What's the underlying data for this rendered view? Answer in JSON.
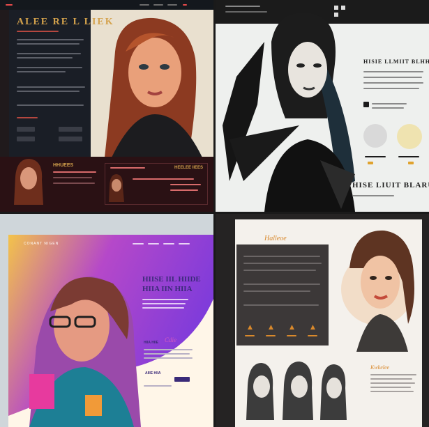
{
  "panel_top_left": {
    "heading": "ALEE RE L LIEK",
    "card_title": "HHUEES",
    "card_tag": "HEELEE IIEES",
    "colors": {
      "accent": "#d4a24c",
      "pink": "#d86b6b",
      "bg": "#201a1c",
      "beige": "#e9e0cf"
    }
  },
  "panel_top_right": {
    "heading": "HISIE LLMIIT BLHHLL",
    "hero_text": "HISE LIUIT BLARUL",
    "nav_icons": [
      "square-icon",
      "square-icon",
      "square-icon"
    ]
  },
  "panel_bottom_left": {
    "brand": "CONANT NIGEN",
    "heading_line1": "HIISE IIL HIIDE",
    "heading_line2": "HIIA IIN HIIA",
    "script": "Cdie",
    "small_label": "HIIA HIIE",
    "cta_label": "AIIIE HIIA",
    "colors": {
      "purple": "#8f3fd8",
      "yellow": "#f3c34a",
      "magenta": "#e73a9e",
      "navy": "#3a2a78"
    }
  },
  "panel_bottom_right": {
    "signature_top": "Halleoe",
    "signature_bottom": "Kwkelee",
    "stat_icons": [
      "flame-icon",
      "flame-icon",
      "flame-icon",
      "flame-icon"
    ],
    "colors": {
      "orange": "#d9892c",
      "dark": "#3c3838"
    }
  }
}
